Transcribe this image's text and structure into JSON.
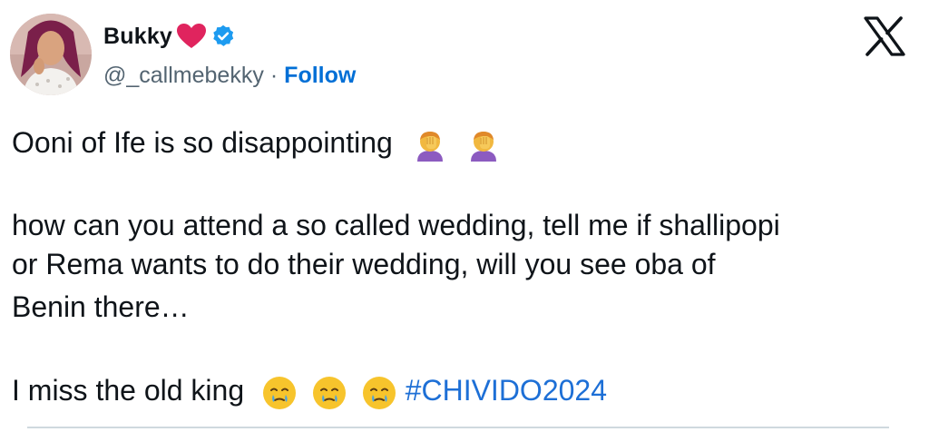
{
  "author": {
    "display_name": "Bukky",
    "handle": "@_callmebekky",
    "separator": "·",
    "follow_label": "Follow",
    "avatar_icon": "avatar-photo",
    "verified_icon": "verified-badge-icon",
    "name_emoji_icon": "red-heart-icon"
  },
  "platform": {
    "logo_icon": "x-logo-icon"
  },
  "tweet": {
    "line1": "Ooni of Ife is so disappointing",
    "line1_emojis": [
      "person-facepalming-icon",
      "person-facepalming-icon"
    ],
    "line2": "how can you attend a so called wedding, tell me if shallipopi",
    "line3": "or Rema wants to do their wedding, will you see oba of",
    "line4": "Benin there…",
    "line5": "I miss the old king",
    "line5_emojis": [
      "face-holding-back-tears-icon",
      "face-holding-back-tears-icon",
      "face-holding-back-tears-icon"
    ],
    "hashtag": "#CHIVIDO2024"
  },
  "colors": {
    "link": "#1d6fd6",
    "verified": "#1d9bf0",
    "heart": "#e0245e",
    "text": "#0f1419",
    "secondary": "#536471"
  }
}
